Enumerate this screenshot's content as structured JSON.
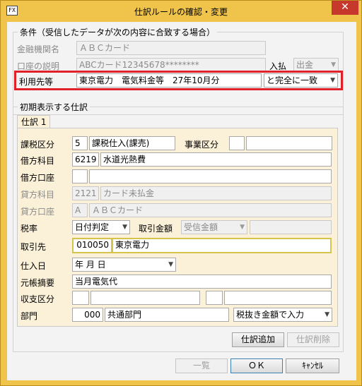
{
  "window": {
    "title": "仕訳ルールの確認・変更",
    "icon_text": "FX",
    "close_glyph": "✕"
  },
  "conditions": {
    "group_label": "条件（受信したデータが次の内容に合致する場合）",
    "bank_label": "金融機関名",
    "bank_value": "ＡＢＣカード",
    "account_label": "口座の説明",
    "account_value": "ABCカード12345678********",
    "inout_label": "入払",
    "inout_value": "出金",
    "payee_label": "利用先等",
    "payee_value": "東京電力　電気料金等　27年10月分",
    "match_value": "と完全に一致"
  },
  "initial": {
    "group_label": "初期表示する仕訳",
    "tab_label": "仕訳 1",
    "tax_label": "課税区分",
    "tax_code": "5",
    "tax_name": "課税仕入(課売)",
    "biz_label": "事業区分",
    "biz_code": "",
    "biz_name": "",
    "debit_label": "借方科目",
    "debit_code": "6219",
    "debit_name": "水道光熱費",
    "debit_acct_label": "借方口座",
    "debit_acct_code": "",
    "debit_acct_name": "",
    "credit_label": "貸方科目",
    "credit_code": "2121",
    "credit_name": "カード未払金",
    "credit_acct_label": "貸方口座",
    "credit_acct_code": "A",
    "credit_acct_name": "ＡＢＣカード",
    "taxrate_label": "税率",
    "taxrate_value": "日付判定",
    "amount_label": "取引金額",
    "amount_value": "受信金額",
    "amount_extra": "",
    "partner_label": "取引先",
    "partner_code": "010050",
    "partner_name": "東京電力",
    "date_label": "仕入日",
    "date_value": "年 月 日",
    "summary_label": "元帳摘要",
    "summary_value": "当月電気代",
    "balance_label": "収支区分",
    "balance_code1": "",
    "balance_name1": "",
    "balance_code2": "",
    "balance_name2": "",
    "dept_label": "部門",
    "dept_code": "000",
    "dept_name": "共通部門",
    "dept_mode": "税抜き金額で入力"
  },
  "buttons": {
    "add_entry": "仕訳追加",
    "delete_entry": "仕訳削除",
    "list": "一覧",
    "ok": "ＯＫ",
    "cancel": "ｷｬﾝｾﾙ"
  }
}
